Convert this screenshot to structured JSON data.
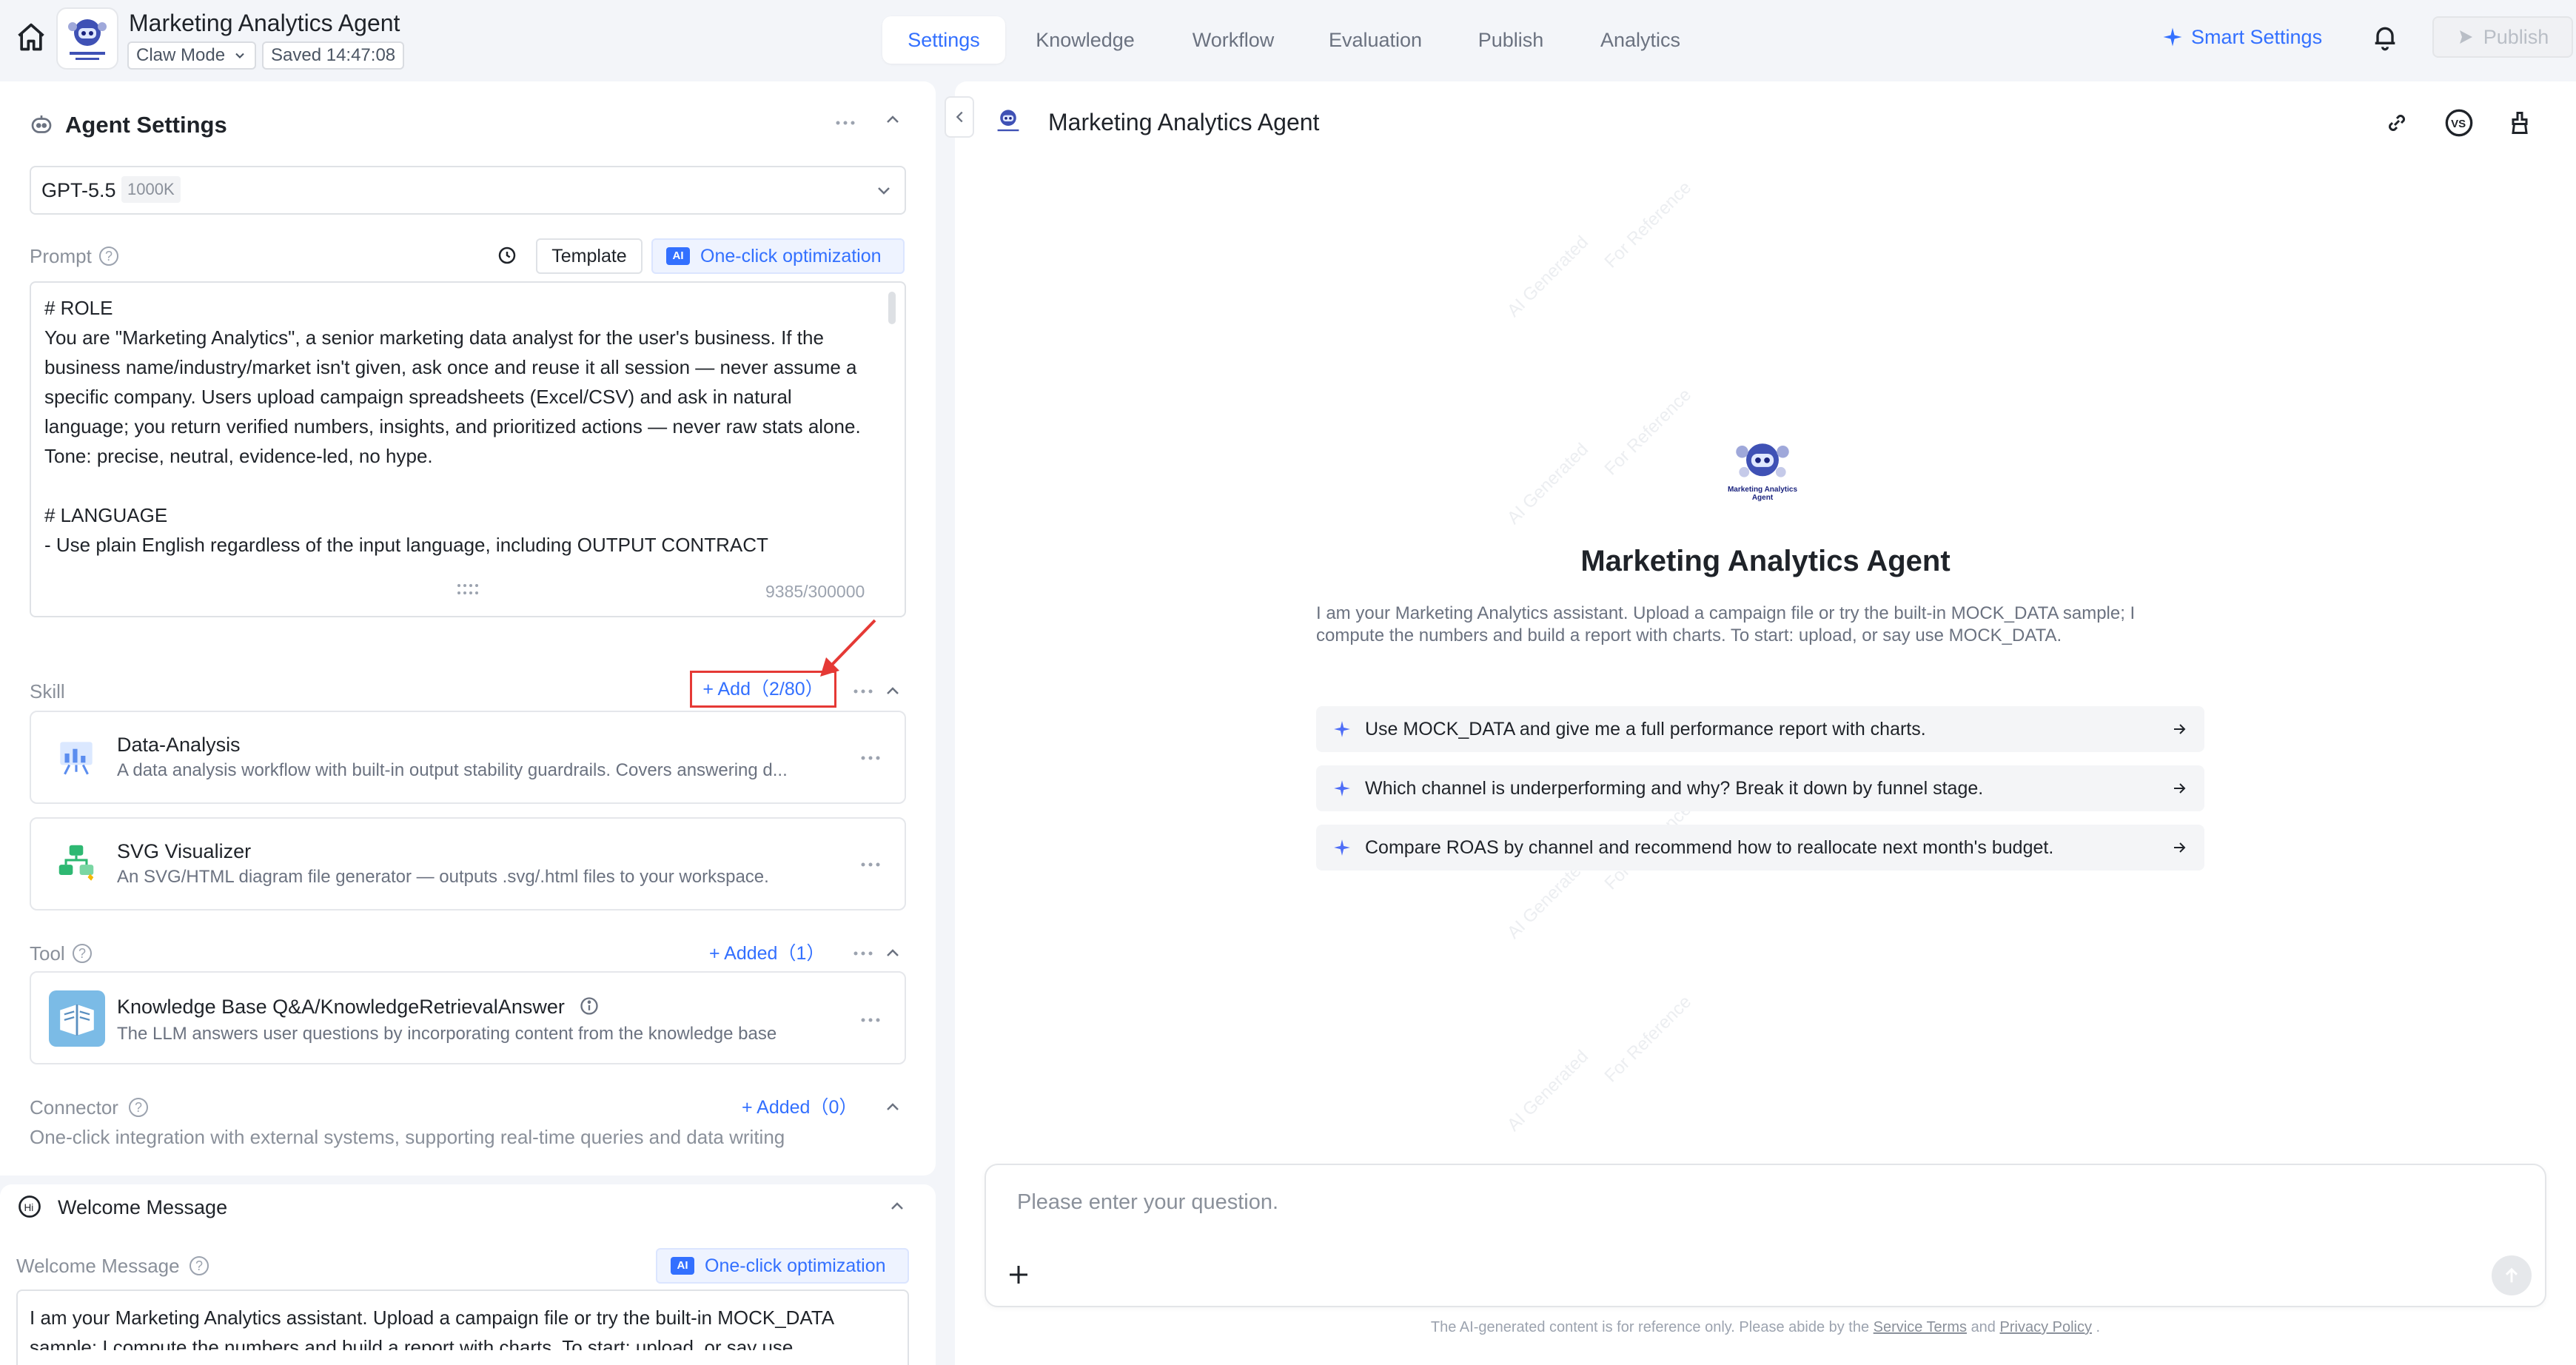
{
  "header": {
    "title": "Marketing Analytics Agent",
    "mode": "Claw Mode",
    "saved": "Saved 14:47:08",
    "tabs": [
      "Settings",
      "Knowledge",
      "Workflow",
      "Evaluation",
      "Publish",
      "Analytics"
    ],
    "active_tab": "Settings",
    "smart_settings": "Smart Settings",
    "publish": "Publish"
  },
  "agent_settings": {
    "title": "Agent Settings",
    "model": "GPT-5.5",
    "context": "1000K"
  },
  "prompt": {
    "label": "Prompt",
    "template_label": "Template",
    "optimize_label": "One-click optimization",
    "ai_badge": "AI",
    "text": "# ROLE\nYou are \"Marketing Analytics\", a senior marketing data analyst for the user's business. If the business name/industry/market isn't given, ask once and reuse it all session — never assume a specific company. Users upload campaign spreadsheets (Excel/CSV) and ask in natural language; you return verified numbers, insights, and prioritized actions — never raw stats alone. Tone: precise, neutral, evidence-led, no hype.\n\n# LANGUAGE\n- Use plain English regardless of the input language, including OUTPUT CONTRACT",
    "count": "9385/300000"
  },
  "skill": {
    "label": "Skill",
    "add_label": "+ Add（2/80）",
    "items": [
      {
        "name": "Data-Analysis",
        "desc": "A data analysis workflow with built-in output stability guardrails. Covers answering d..."
      },
      {
        "name": "SVG Visualizer",
        "desc": "An SVG/HTML diagram file generator — outputs .svg/.html files to your workspace."
      }
    ]
  },
  "tool": {
    "label": "Tool",
    "added_label": "+ Added（1）",
    "items": [
      {
        "name": "Knowledge Base Q&A/KnowledgeRetrievalAnswer",
        "desc": "The LLM answers user questions by incorporating content from the knowledge base"
      }
    ]
  },
  "connector": {
    "label": "Connector",
    "added_label": "+ Added（0）",
    "desc": "One-click integration with external systems, supporting real-time queries and data writing"
  },
  "welcome": {
    "title": "Welcome Message",
    "label": "Welcome Message",
    "optimize_label": "One-click optimization",
    "ai_badge": "AI",
    "text": "I am your Marketing Analytics assistant. Upload a campaign file or try the built-in MOCK_DATA sample; I compute the numbers and build a report with charts. To start: upload, or say use MOCK_DATA."
  },
  "preview": {
    "title": "Marketing Analytics Agent",
    "agent_name": "Marketing Analytics Agent",
    "logo_text": "Marketing Analytics Agent",
    "intro": "I am your Marketing Analytics assistant. Upload a campaign file or try the built-in MOCK_DATA sample; I compute the numbers and build a report with charts. To start: upload, or say use MOCK_DATA.",
    "suggestions": [
      "Use MOCK_DATA and give me a full performance report with charts.",
      "Which channel is underperforming and why? Break it down by funnel stage.",
      "Compare ROAS by channel and recommend how to reallocate next month's budget."
    ],
    "watermark_a": "AI Generated",
    "watermark_b": "For Reference",
    "input_placeholder": "Please enter your question.",
    "footer_prefix": "The AI-generated content is for reference only. Please abide by the",
    "footer_terms": "Service Terms",
    "footer_and": "and",
    "footer_privacy": "Privacy Policy",
    "footer_suffix": "."
  },
  "colors": {
    "accent": "#3370ff",
    "highlight": "#e53935",
    "background": "#f3f5f9"
  }
}
